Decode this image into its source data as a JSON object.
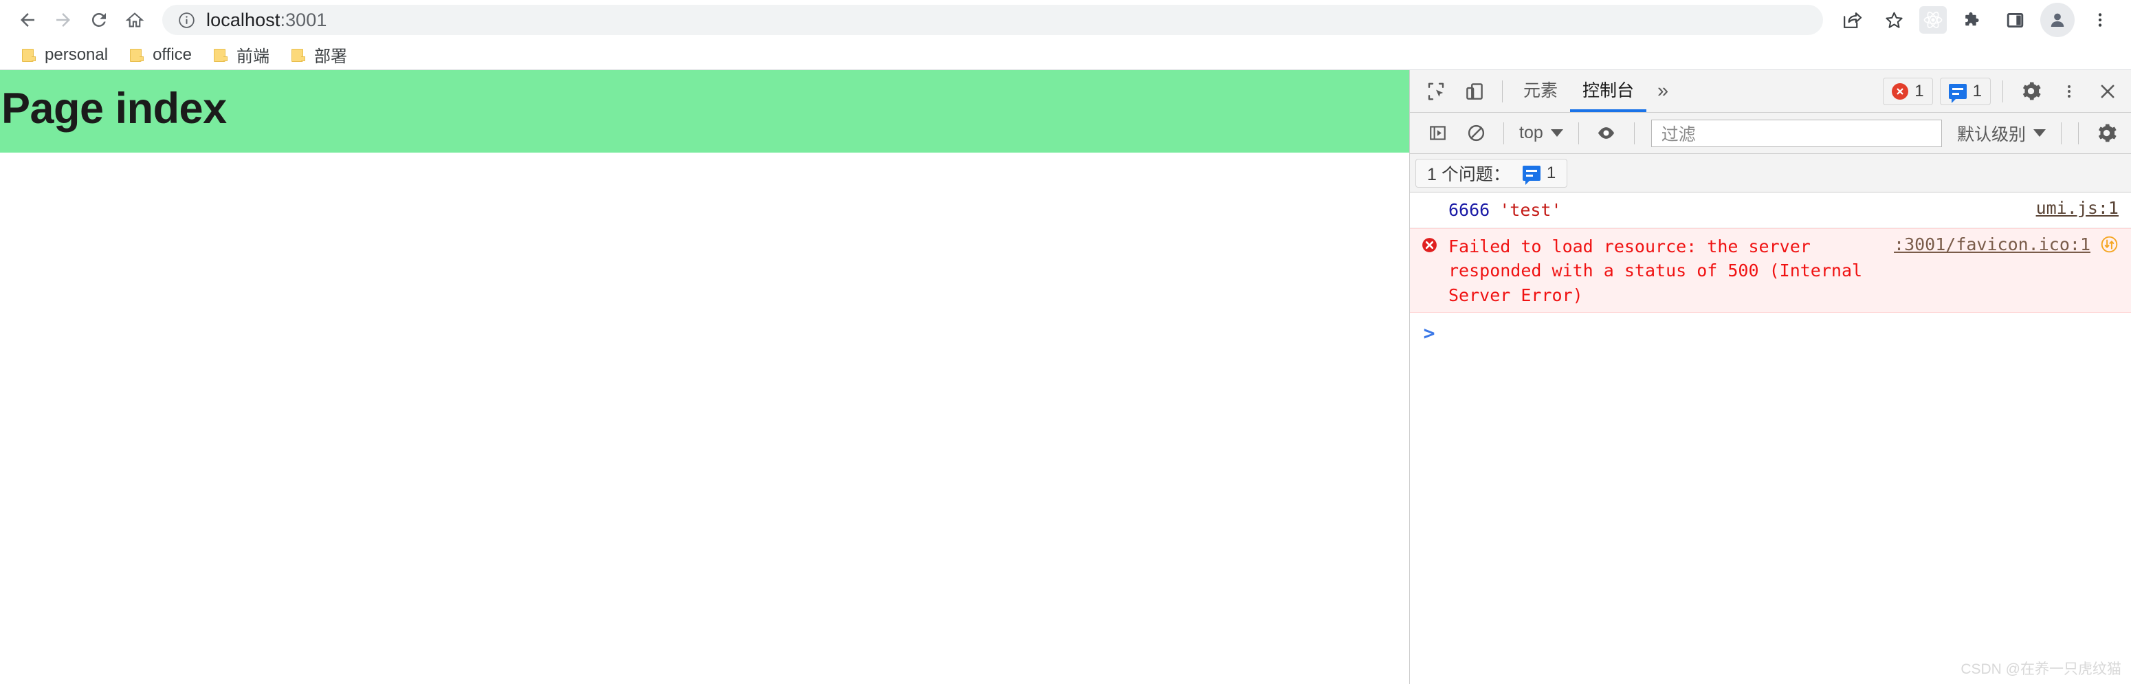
{
  "browser": {
    "nav": {
      "back_label": "Back",
      "forward_label": "Forward",
      "reload_label": "Reload",
      "home_label": "Home"
    },
    "omnibox": {
      "info_icon": "info-circle-icon",
      "host": "localhost",
      "port": ":3001",
      "full_url": "localhost:3001"
    },
    "toolbar_icons": [
      {
        "name": "share-icon",
        "label": "Share"
      },
      {
        "name": "bookmark-star-icon",
        "label": "Bookmark this tab"
      },
      {
        "name": "react-devtools-extension-icon",
        "label": "React Developer Tools"
      },
      {
        "name": "extensions-puzzle-icon",
        "label": "Extensions"
      },
      {
        "name": "side-panel-icon",
        "label": "Side panel"
      },
      {
        "name": "profile-avatar-icon",
        "label": "Profile"
      },
      {
        "name": "chrome-menu-kebab-icon",
        "label": "Customize and control Google Chrome"
      }
    ],
    "bookmarks": [
      {
        "label": "personal",
        "icon": "folder-icon"
      },
      {
        "label": "office",
        "icon": "folder-icon"
      },
      {
        "label": "前端",
        "icon": "folder-icon"
      },
      {
        "label": "部署",
        "icon": "folder-icon"
      }
    ]
  },
  "page": {
    "title": "Page index",
    "banner_color": "#7aeb9e",
    "background_color": "#ffffff"
  },
  "devtools": {
    "toolbar": {
      "inspect_icon": "inspect-element-icon",
      "device_icon": "device-toolbar-icon",
      "settings_icon": "gear-icon",
      "kebab_icon": "more-options-kebab-icon",
      "close_icon": "close-icon"
    },
    "tabs": [
      {
        "label": "元素",
        "name": "tab-elements",
        "active": false
      },
      {
        "label": "控制台",
        "name": "tab-console",
        "active": true
      }
    ],
    "overflow_label": "»",
    "badges": {
      "errors": "1",
      "messages": "1"
    },
    "console_toolbar": {
      "sidebar_icon": "console-sidebar-icon",
      "clear_icon": "clear-console-icon",
      "context": "top",
      "eye_icon": "live-expression-eye-icon",
      "filter_placeholder": "过滤",
      "filter_value": "",
      "level": "默认级别",
      "settings_icon": "console-settings-gear-icon"
    },
    "issues_bar": {
      "text": "1 个问题：",
      "count": "1",
      "icon": "message-badge-icon"
    },
    "messages": [
      {
        "type": "log",
        "number": "6666",
        "string": "'test'",
        "source": "umi.js:1"
      },
      {
        "type": "error",
        "icon": "error-circle-icon",
        "text": "Failed to load resource: the server responded with a status of 500 (Internal Server Error)",
        "source": ":3001/favicon.ico:1",
        "network_icon": "network-request-icon"
      }
    ],
    "prompt": ">"
  },
  "watermark": "CSDN @在养一只虎纹猫"
}
